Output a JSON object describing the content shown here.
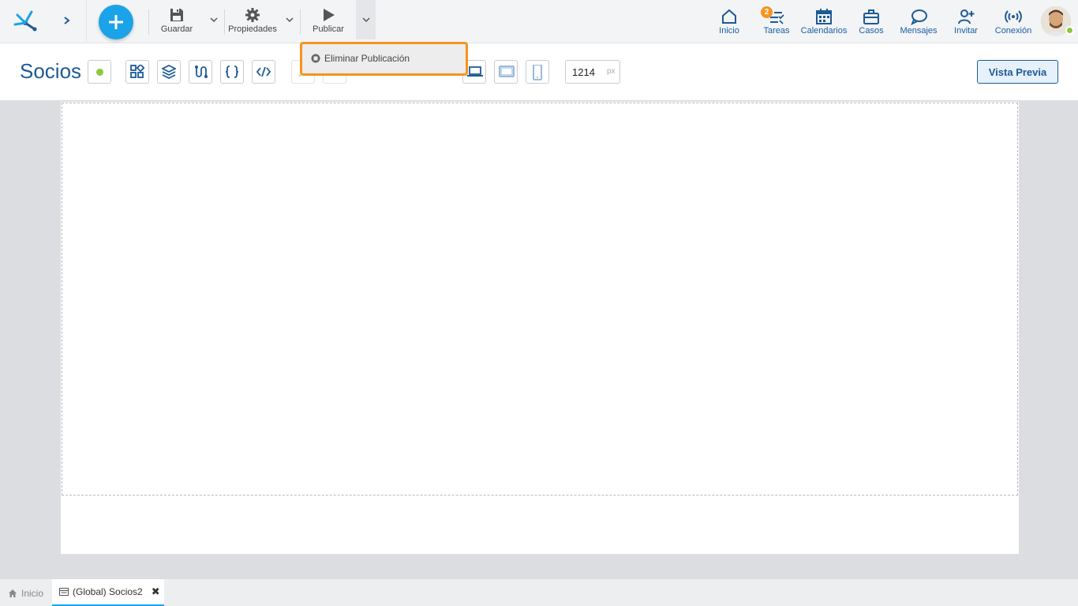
{
  "toolbar": {
    "guardar_label": "Guardar",
    "propiedades_label": "Propiedades",
    "publicar_label": "Publicar"
  },
  "nav": {
    "inicio": "Inicio",
    "tareas": "Tareas",
    "tareas_badge": "2",
    "calendarios": "Calendarios",
    "casos": "Casos",
    "mensajes": "Mensajes",
    "invitar": "Invitar",
    "conexion": "Conexión"
  },
  "editor": {
    "title": "Socios",
    "width_value": "1214",
    "width_unit": "px",
    "preview_label": "Vista Previa"
  },
  "dropdown": {
    "item_label": "Eliminar Publicación"
  },
  "tabs": {
    "home_label": "Inicio",
    "active_label": "(Global) Socios2"
  },
  "colors": {
    "accent": "#1aa3e8",
    "primary": "#1e5a96",
    "highlight": "#f7941d",
    "status_ok": "#8dc63f"
  }
}
